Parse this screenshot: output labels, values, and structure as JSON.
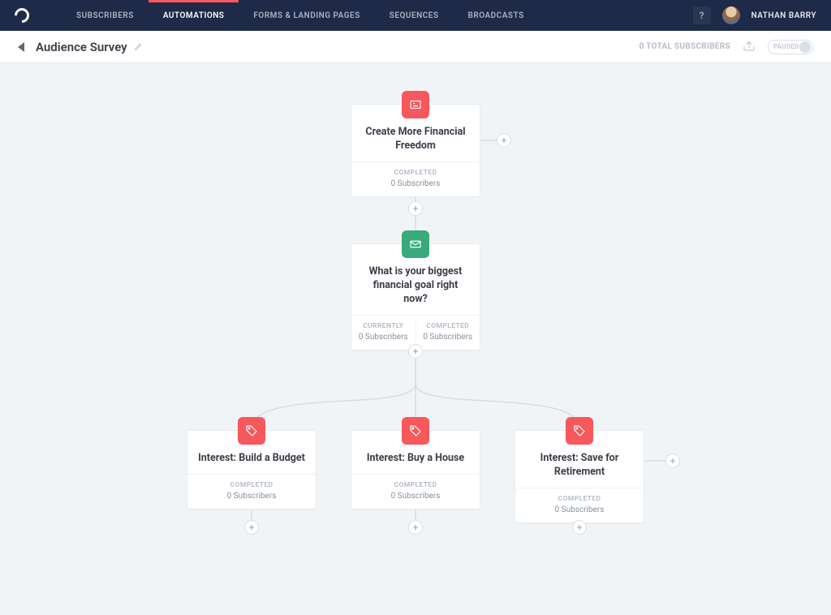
{
  "nav": {
    "items": [
      {
        "label": "SUBSCRIBERS"
      },
      {
        "label": "AUTOMATIONS"
      },
      {
        "label": "FORMS & LANDING PAGES"
      },
      {
        "label": "SEQUENCES"
      },
      {
        "label": "BROADCASTS"
      }
    ],
    "help": "?",
    "username": "NATHAN BARRY"
  },
  "subheader": {
    "title": "Audience Survey",
    "total_subs": "0 TOTAL SUBSCRIBERS",
    "toggle_label": "PAUSED"
  },
  "nodes": {
    "n1": {
      "title": "Create More Financial Freedom",
      "foot_label": "COMPLETED",
      "foot_value": "0 Subscribers"
    },
    "n2": {
      "title": "What is your biggest financial goal right now?",
      "left_label": "CURRENTLY",
      "left_value": "0 Subscribers",
      "right_label": "COMPLETED",
      "right_value": "0 Subscribers"
    },
    "n3": {
      "title": "Interest: Build a Budget",
      "foot_label": "COMPLETED",
      "foot_value": "0 Subscribers"
    },
    "n4": {
      "title": "Interest: Buy a House",
      "foot_label": "COMPLETED",
      "foot_value": "0 Subscribers"
    },
    "n5": {
      "title": "Interest: Save for Retirement",
      "foot_label": "COMPLETED",
      "foot_value": "0 Subscribers"
    }
  }
}
